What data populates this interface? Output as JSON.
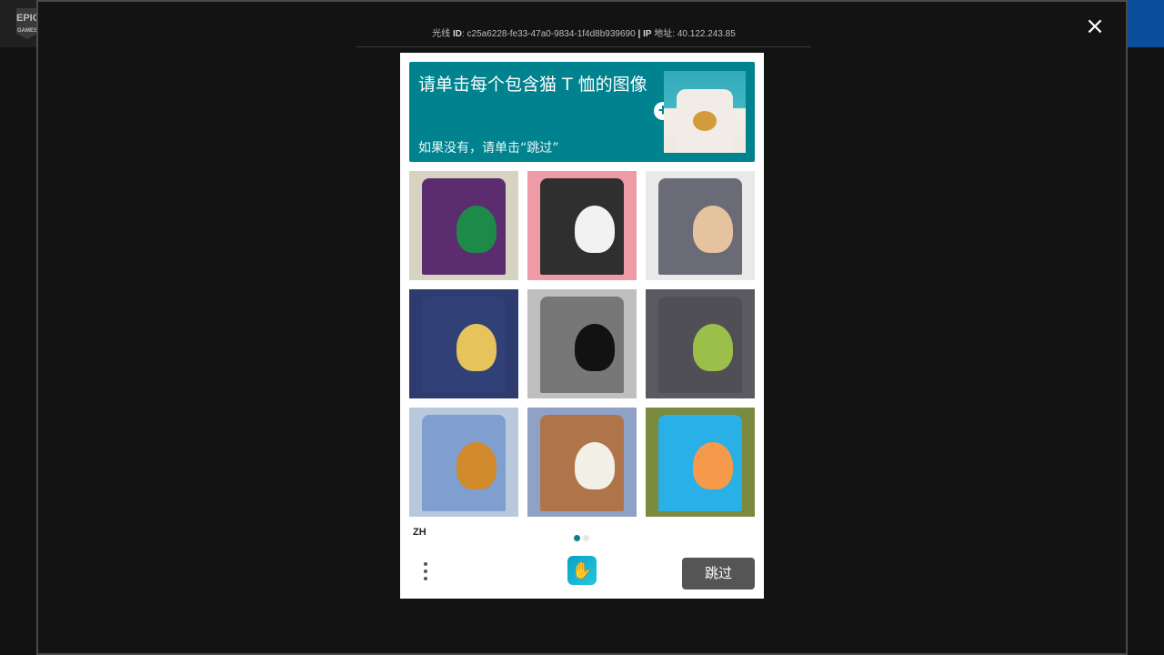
{
  "topbar": {
    "logo_text": "EPIC",
    "logo_sub": "GAMES"
  },
  "modal": {
    "id_prefix": "光线",
    "id_label": "ID",
    "id_value": "c25a6228-fe33-47a0-9834-1f4d8b939690",
    "sep": "|",
    "ip_label": "IP",
    "ip_suffix": "地址",
    "ip_value": "40.122.243.85",
    "close_icon": "×"
  },
  "captcha": {
    "banner": {
      "title": "请单击每个包含猫 T 恤的图像",
      "subtitle": "如果没有，请单击“跳过”",
      "plus_icon": "+"
    },
    "tiles": [
      {
        "name": "tile-bat-colorful",
        "bg": "#d8d2c0",
        "tee": "#5b2d6e",
        "art": "#1e8a4a"
      },
      {
        "name": "tile-cat-pink-black",
        "bg": "#ef9aa7",
        "tee": "#2f2f2f",
        "art": "#f2f2f2"
      },
      {
        "name": "tile-cat-gray",
        "bg": "#e9e9e9",
        "tee": "#6b6b78",
        "art": "#e6c39f"
      },
      {
        "name": "tile-cat-navy",
        "bg": "#2d3b6f",
        "tee": "#314077",
        "art": "#e7c35c"
      },
      {
        "name": "tile-otter-swirl",
        "bg": "#bfbfbf",
        "tee": "#777777",
        "art": "#121212"
      },
      {
        "name": "tile-bat-gray",
        "bg": "#5a5a60",
        "tee": "#4f4f55",
        "art": "#9cbf4a"
      },
      {
        "name": "tile-dog-blue",
        "bg": "#b9c9dd",
        "tee": "#7f9fcf",
        "art": "#d18a2c"
      },
      {
        "name": "tile-cat-brown",
        "bg": "#8fa2c6",
        "tee": "#b0744a",
        "art": "#f2efe7"
      },
      {
        "name": "tile-cat-cyan",
        "bg": "#7a8a3f",
        "tee": "#29b0e6",
        "art": "#f59a4a"
      }
    ],
    "lang": "ZH",
    "dots": {
      "active": "#00838f",
      "inactive": "#e5e5e5"
    },
    "skip_label": "跳过"
  }
}
